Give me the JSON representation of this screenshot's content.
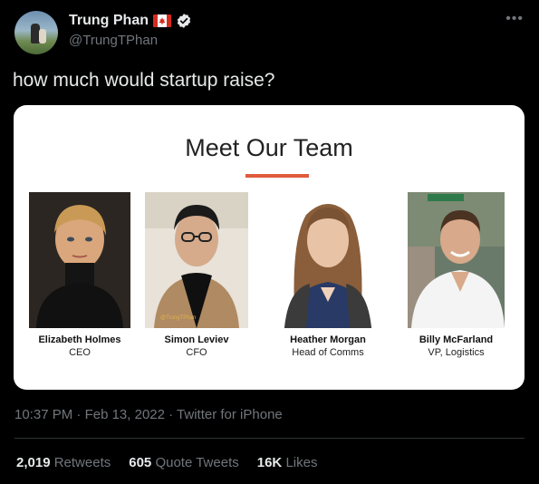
{
  "author": {
    "display_name": "Trung Phan",
    "handle": "@TrungTPhan"
  },
  "tweet_text": "how much would startup raise?",
  "media": {
    "title": "Meet Our Team",
    "members": [
      {
        "name": "Elizabeth Holmes",
        "role": "CEO"
      },
      {
        "name": "Simon Leviev",
        "role": "CFO",
        "watermark": "@TrungTPhan"
      },
      {
        "name": "Heather Morgan",
        "role": "Head of Comms"
      },
      {
        "name": "Billy McFarland",
        "role": "VP, Logistics"
      }
    ],
    "accent_color": "#e05a3c"
  },
  "meta": {
    "time": "10:37 PM",
    "date": "Feb 13, 2022",
    "source": "Twitter for iPhone",
    "separator": "·"
  },
  "stats": {
    "retweets_count": "2,019",
    "retweets_label": "Retweets",
    "quotes_count": "605",
    "quotes_label": "Quote Tweets",
    "likes_count": "16K",
    "likes_label": "Likes"
  },
  "icons": {
    "more": "more-options-icon",
    "verified": "verified-badge-icon",
    "flag": "canada-flag-icon"
  }
}
